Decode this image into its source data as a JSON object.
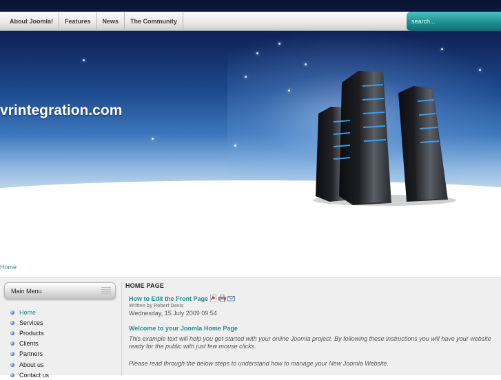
{
  "nav": {
    "items": [
      {
        "label": "About Joomla!"
      },
      {
        "label": "Features"
      },
      {
        "label": "News"
      },
      {
        "label": "The Community"
      }
    ],
    "search_placeholder": "search..."
  },
  "header": {
    "site_title": "vrintegration.com"
  },
  "breadcrumb": {
    "label": "Home"
  },
  "sidebar": {
    "title": "Main Menu",
    "items": [
      {
        "label": "Home",
        "active": true
      },
      {
        "label": "Services"
      },
      {
        "label": "Products"
      },
      {
        "label": "Clients"
      },
      {
        "label": "Partners"
      },
      {
        "label": "About us"
      },
      {
        "label": "Contact us"
      }
    ]
  },
  "main": {
    "heading": "HOME PAGE",
    "article_title": "How to Edit the Front Page",
    "icons": [
      "pdf-icon",
      "print-icon",
      "email-icon"
    ],
    "author": "Written by Robert Davis",
    "date": "Wednesday, 15 July 2009 09:54",
    "welcome": "Welcome to your Joomla Home Page",
    "intro": "This example text will help you get started with your online Joomla project. By following these instructions you will have your website ready for the public with just few mouse clicks.",
    "steps": "Please read through the below steps to understand how to manage your New Joomla Website."
  },
  "colors": {
    "accent": "#2a8a8c",
    "search_bg": "#1e8f92",
    "header_dark": "#10245a"
  }
}
